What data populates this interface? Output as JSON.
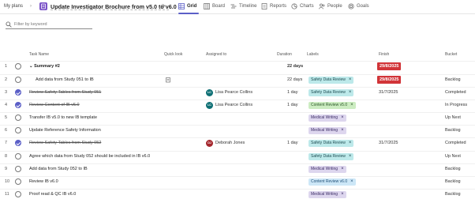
{
  "breadcrumb": {
    "my_plans": "My plans"
  },
  "plan": {
    "title": "Update Investigator Brochure from v5.0 to v6.0"
  },
  "tabs": [
    {
      "label": "Grid",
      "icon": "grid-icon"
    },
    {
      "label": "Board",
      "icon": "board-icon"
    },
    {
      "label": "Timeline",
      "icon": "timeline-icon"
    },
    {
      "label": "Reports",
      "icon": "reports-icon"
    },
    {
      "label": "Charts",
      "icon": "charts-icon"
    },
    {
      "label": "People",
      "icon": "people-icon"
    },
    {
      "label": "Goals",
      "icon": "goals-icon"
    }
  ],
  "filter": {
    "placeholder": "Filter by keyword"
  },
  "columns": {
    "task_name": "Task Name",
    "quick_look": "Quick look",
    "assigned_to": "Assigned to",
    "duration": "Duration",
    "labels": "Labels",
    "finish": "Finish",
    "bucket": "Bucket"
  },
  "colors": {
    "accent": "#5b5fc7",
    "overdue": "#d13438",
    "avatar_teal": "#0e6f74",
    "avatar_red": "#a4262c"
  },
  "rows": [
    {
      "num": "1",
      "check": "",
      "task": "Summary #2",
      "duration": "22 days",
      "labels": [],
      "finish": "29/8/2025",
      "bucket": ""
    },
    {
      "num": "2",
      "check": "",
      "task": "Add data from Study 051 to IB",
      "duration": "22 days",
      "labels": [
        {
          "text": "Safety Data Review"
        }
      ],
      "finish": "29/8/2025",
      "bucket": "Backlog"
    },
    {
      "num": "3",
      "check": "done",
      "task": "Review Safety Tables from Study 051",
      "initials": "LC",
      "assignee": "Lisa Pearce Collins",
      "duration": "1 day",
      "labels": [
        {
          "text": "Safety Data Review"
        }
      ],
      "finish": "31/7/2025",
      "bucket": "Completed"
    },
    {
      "num": "4",
      "check": "done",
      "task": "Review Content of IB v5.0",
      "initials": "LC",
      "assignee": "Lisa Pearce Collins",
      "duration": "1 day",
      "labels": [
        {
          "text": "Content Review v5.0"
        }
      ],
      "finish": "",
      "bucket": "In Progress"
    },
    {
      "num": "5",
      "check": "",
      "task": "Transfer IB v5.0 to new IB template",
      "duration": "",
      "labels": [
        {
          "text": "Medical Writing"
        }
      ],
      "finish": "",
      "bucket": "Up Next"
    },
    {
      "num": "6",
      "check": "",
      "task": "Update Reference Safety Information",
      "duration": "",
      "labels": [
        {
          "text": "Medical Writing"
        }
      ],
      "finish": "",
      "bucket": "Backlog"
    },
    {
      "num": "7",
      "check": "done",
      "task": "Review Safety Tables from Study 052",
      "initials": "DJ",
      "assignee": "Deborah Jones",
      "duration": "1 day",
      "labels": [
        {
          "text": "Safety Data Review"
        }
      ],
      "finish": "31/7/2025",
      "bucket": "Completed"
    },
    {
      "num": "8",
      "check": "",
      "task": "Agree which data from Study 052 should be included in IB v6.0",
      "duration": "",
      "labels": [
        {
          "text": "Safety Data Review"
        }
      ],
      "finish": "",
      "bucket": "Up Next"
    },
    {
      "num": "9",
      "check": "",
      "task": "Add data from Study 052 to IB",
      "duration": "",
      "labels": [
        {
          "text": "Medical Writing"
        }
      ],
      "finish": "",
      "bucket": "Backlog"
    },
    {
      "num": "10",
      "check": "",
      "task": "Review IB v6.0",
      "duration": "",
      "labels": [
        {
          "text": "Content Review v6.0"
        }
      ],
      "finish": "",
      "bucket": "Backlog"
    },
    {
      "num": "11",
      "check": "",
      "task": "Proof read & QC IB v6.0",
      "duration": "",
      "labels": [
        {
          "text": "Medical Writing"
        }
      ],
      "finish": "",
      "bucket": "Backlog"
    }
  ]
}
